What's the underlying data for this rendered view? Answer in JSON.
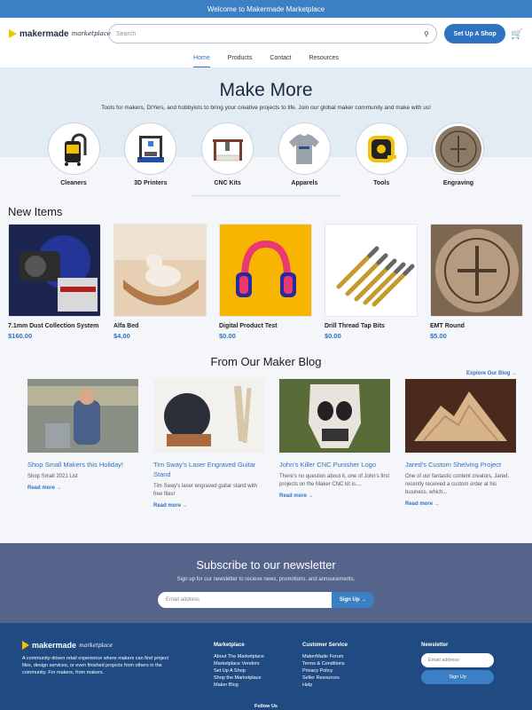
{
  "topbar": {
    "text": "Welcome to Makermade Marketplace"
  },
  "header": {
    "logo_word": "makermade",
    "logo_script": "marketplace",
    "search_placeholder": "Search",
    "setup_shop": "Set Up A Shop"
  },
  "nav": [
    "Home",
    "Products",
    "Contact",
    "Resources"
  ],
  "hero": {
    "title": "Make More",
    "subtitle": "Tools for makers, DIYers, and hobbyists to bring your creative projects to life. Join our global maker community and make with us!"
  },
  "categories": [
    "Cleaners",
    "3D Printers",
    "CNC Kits",
    "Apparels",
    "Tools",
    "Engraving"
  ],
  "new_items": {
    "title": "New Items",
    "items": [
      {
        "name": "7.1mm Dust Collection System",
        "price": "$160.00"
      },
      {
        "name": "Alfa Bed",
        "price": "$4.00"
      },
      {
        "name": "Digital Product Test",
        "price": "$0.00"
      },
      {
        "name": "Drill Thread Tap Bits",
        "price": "$0.00"
      },
      {
        "name": "EMT Round",
        "price": "$5.00"
      }
    ]
  },
  "blog": {
    "title": "From Our Maker Blog",
    "explore": "Explore Our Blog →",
    "posts": [
      {
        "title": "Shop Small Makers this Holiday!",
        "desc": "Shop Small 2021 List",
        "more": "Read more →"
      },
      {
        "title": "Tim Sway's Laser Engraved Guitar Stand",
        "desc": "Tim Sway's laser engraved guitar stand with free files!",
        "more": "Read more →"
      },
      {
        "title": "John's Killer CNC Punisher Logo",
        "desc": "There's no question about it, one of John's first projects on the Maker CNC kit is....",
        "more": "Read more →"
      },
      {
        "title": "Jared's Custom Shelving Project",
        "desc": "One of our fantastic content creators, Jared, recently received a custom order at his business, which...",
        "more": "Read more →"
      }
    ]
  },
  "newsletter": {
    "title": "Subscribe to our newsletter",
    "subtitle": "Sign up for our newsletter to recieve news, promotions, and annoucements.",
    "placeholder": "Email address",
    "button": "Sign Up →"
  },
  "footer": {
    "about": "A community-driven retail experience where makers can find project files, design services, or even finished projects from others in the community. For makers, from makers.",
    "marketplace_title": "Marketplace",
    "marketplace_links": [
      "About The Marketplace",
      "Marketplace Vendors",
      "Set Up A Shop",
      "Shop the Marketplace",
      "Maker Blog"
    ],
    "service_title": "Customer Service",
    "service_links": [
      "MakerMade Forum",
      "Terms & Conditions",
      "Privacy Policy",
      "Seller Resources",
      "Help"
    ],
    "newsletter_title": "Newsletter",
    "newsletter_placeholder": "Email address",
    "newsletter_button": "Sign Up",
    "follow": "Follow Us"
  },
  "colors": {
    "accent": "#2f73c0",
    "newsletter_bg": "#56648c",
    "footer_bg": "#1f4a82",
    "logo": "#f2c300"
  }
}
